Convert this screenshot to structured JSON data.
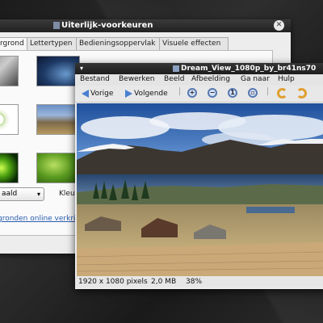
{
  "back_window": {
    "title": "Uiterlijk-voorkeuren",
    "tabs": [
      {
        "label": "rgrond"
      },
      {
        "label": "Lettertypen"
      },
      {
        "label": "Bedieningsoppervlak"
      },
      {
        "label": "Visuele effecten"
      }
    ],
    "style_combo_value": "aald",
    "colors_label": "Kleu",
    "online_link": "gronden online verkri"
  },
  "front_window": {
    "title": "Dream_View_1080p_by_br41ns70",
    "menus": [
      "Bestand",
      "Bewerken",
      "Beeld",
      "Afbeelding",
      "Ga naar",
      "Hulp"
    ],
    "toolbar": {
      "prev_label": "Vorige",
      "next_label": "Volgende"
    },
    "status": {
      "dimensions": "1920 x 1080 pixels",
      "size": "2,0 MB",
      "zoom": "38%"
    }
  },
  "icons": [
    "close-icon",
    "menu-arrow-icon",
    "back-arrow-icon",
    "forward-arrow-icon",
    "zoom-in-icon",
    "zoom-out-icon",
    "zoom-normal-icon",
    "zoom-fit-icon",
    "rotate-left-icon",
    "rotate-right-icon"
  ]
}
